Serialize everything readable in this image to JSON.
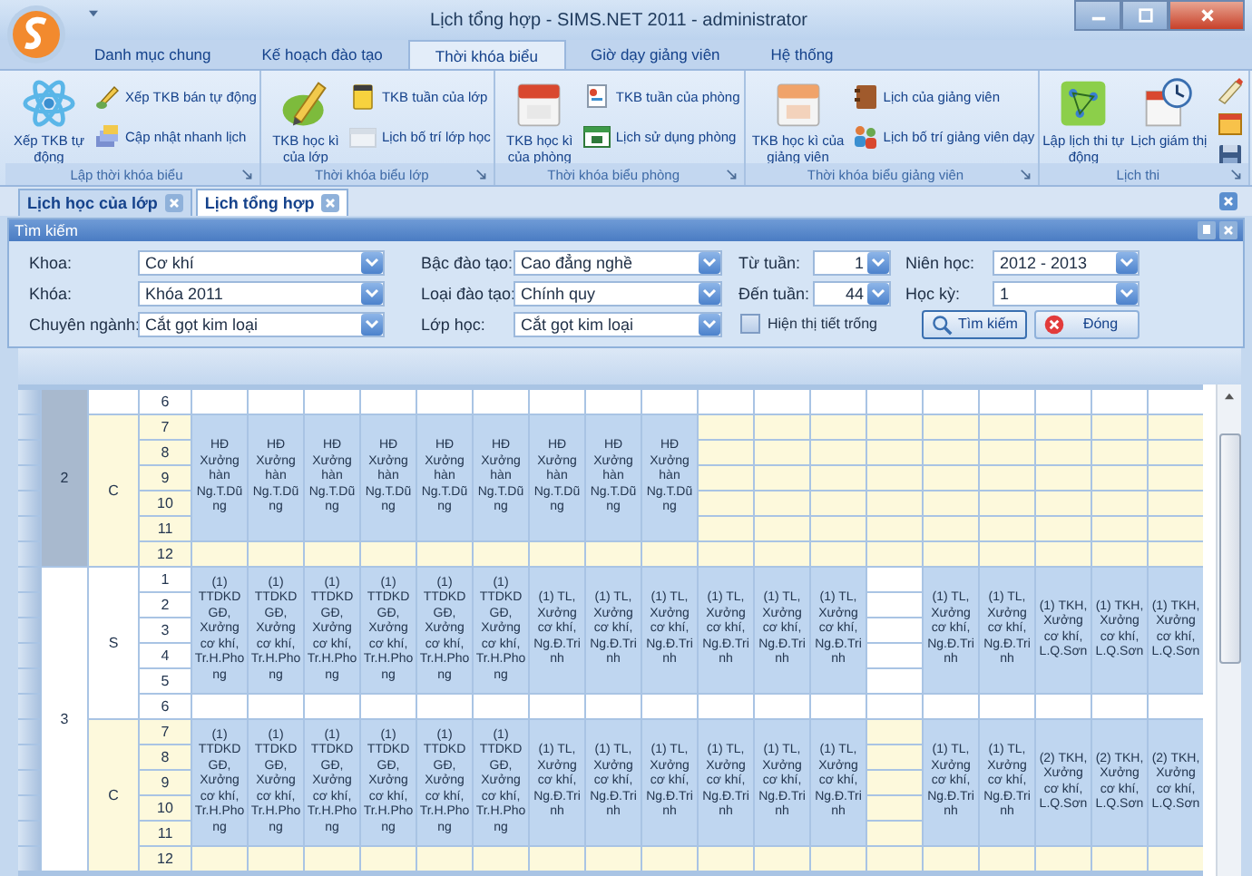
{
  "window": {
    "title": "Lịch tổng hợp - SIMS.NET 2011 - administrator"
  },
  "ribbon": {
    "tabs": [
      {
        "label": "Danh mục chung",
        "selected": false
      },
      {
        "label": "Kế hoạch đào tạo",
        "selected": false
      },
      {
        "label": "Thời khóa biểu",
        "selected": true
      },
      {
        "label": "Giờ dạy giảng viên",
        "selected": false
      },
      {
        "label": "Hệ thống",
        "selected": false
      }
    ],
    "groups": [
      {
        "label": "Lập thời khóa biểu",
        "large": [
          "Xếp TKB tự động"
        ],
        "small": [
          "Xếp TKB bán tự động",
          "Cập nhật nhanh lịch"
        ]
      },
      {
        "label": "Thời khóa biểu lớp",
        "large": [
          "TKB học kì của lớp"
        ],
        "small": [
          "TKB tuần của lớp",
          "Lịch bố trí lớp học"
        ]
      },
      {
        "label": "Thời khóa biểu phòng",
        "large": [
          "TKB học kì của phòng"
        ],
        "small": [
          "TKB tuần của phòng",
          "Lịch sử dụng phòng"
        ]
      },
      {
        "label": "Thời khóa biểu giảng viên",
        "large": [
          "TKB học kì của giảng viên"
        ],
        "small": [
          "Lịch của giảng viên",
          "Lịch bố trí giảng viên dạy"
        ]
      },
      {
        "label": "Lịch thi",
        "large": [
          "Lập lịch thi tự động",
          "Lịch giám thị"
        ]
      }
    ]
  },
  "document_tabs": [
    {
      "label": "Lịch học của lớp",
      "selected": false
    },
    {
      "label": "Lịch tổng hợp",
      "selected": true
    }
  ],
  "search_panel": {
    "title": "Tìm kiếm",
    "rows": [
      [
        {
          "label": "Khoa:",
          "value": "Cơ khí"
        },
        {
          "label": "Bậc đào tạo:",
          "value": "Cao đẳng nghề"
        },
        {
          "label": "Từ tuần:",
          "value": "1"
        },
        {
          "label": "Niên học:",
          "value": "2012 - 2013"
        }
      ],
      [
        {
          "label": "Khóa:",
          "value": "Khóa 2011"
        },
        {
          "label": "Loại đào tạo:",
          "value": "Chính quy"
        },
        {
          "label": "Đến tuần:",
          "value": "44"
        },
        {
          "label": "Học kỳ:",
          "value": "1"
        }
      ],
      [
        {
          "label": "Chuyên ngành:",
          "value": "Cắt gọt kim loại"
        },
        {
          "label": "Lớp học:",
          "value": "Cắt gọt kim loại"
        }
      ]
    ],
    "checkbox": {
      "label": "Hiện thị tiết trống",
      "checked": false
    },
    "buttons": [
      {
        "label": "Tìm kiếm"
      },
      {
        "label": "Đóng"
      }
    ]
  },
  "schedule": {
    "days": [
      {
        "label": "2",
        "selected": true,
        "sessions": [
          {
            "kind": "morning",
            "free_periods": [
              "6"
            ]
          },
          {
            "label": "C",
            "kind": "afternoon",
            "lesson_periods": [
              "7",
              "8",
              "9",
              "10",
              "11"
            ],
            "free_periods": [
              "12"
            ],
            "cells": [
              {
                "kind": "lesson",
                "text": "HĐ Xưởng hàn Ng.T.Dũng"
              },
              {
                "kind": "lesson",
                "text": "HĐ Xưởng hàn Ng.T.Dũng"
              },
              {
                "kind": "lesson",
                "text": "HĐ Xưởng hàn Ng.T.Dũng"
              },
              {
                "kind": "lesson",
                "text": "HĐ Xưởng hàn Ng.T.Dũng"
              },
              {
                "kind": "lesson",
                "text": "HĐ Xưởng hàn Ng.T.Dũng"
              },
              {
                "kind": "lesson",
                "text": "HĐ Xưởng hàn Ng.T.Dũng"
              },
              {
                "kind": "lesson",
                "text": "HĐ Xưởng hàn Ng.T.Dũng"
              },
              {
                "kind": "lesson",
                "text": "HĐ Xưởng hàn Ng.T.Dũng"
              },
              {
                "kind": "lesson",
                "text": "HĐ Xưởng hàn Ng.T.Dũng"
              },
              {
                "kind": "free"
              },
              {
                "kind": "free"
              },
              {
                "kind": "free"
              },
              {
                "kind": "free"
              },
              {
                "kind": "free"
              },
              {
                "kind": "free"
              },
              {
                "kind": "free"
              },
              {
                "kind": "free"
              },
              {
                "kind": "free"
              }
            ]
          }
        ]
      },
      {
        "label": "3",
        "selected": false,
        "sessions": [
          {
            "label": "S",
            "kind": "morning",
            "lesson_periods": [
              "1",
              "2",
              "3",
              "4",
              "5"
            ],
            "free_periods": [
              "6"
            ],
            "cells": [
              {
                "kind": "lesson",
                "text": "(1) TTDKD GĐ, Xưởng cơ khí, Tr.H.Phong"
              },
              {
                "kind": "lesson",
                "text": "(1) TTDKD GĐ, Xưởng cơ khí, Tr.H.Phong"
              },
              {
                "kind": "lesson",
                "text": "(1) TTDKD GĐ, Xưởng cơ khí, Tr.H.Phong"
              },
              {
                "kind": "lesson",
                "text": "(1) TTDKD GĐ, Xưởng cơ khí, Tr.H.Phong"
              },
              {
                "kind": "lesson",
                "text": "(1) TTDKD GĐ, Xưởng cơ khí, Tr.H.Phong"
              },
              {
                "kind": "lesson",
                "text": "(1) TTDKD GĐ, Xưởng cơ khí, Tr.H.Phong"
              },
              {
                "kind": "lesson",
                "text": "(1) TL, Xưởng cơ khí, Ng.Đ.Trinh"
              },
              {
                "kind": "lesson",
                "text": "(1) TL, Xưởng cơ khí, Ng.Đ.Trinh"
              },
              {
                "kind": "lesson",
                "text": "(1) TL, Xưởng cơ khí, Ng.Đ.Trinh"
              },
              {
                "kind": "lesson",
                "text": "(1) TL, Xưởng cơ khí, Ng.Đ.Trinh"
              },
              {
                "kind": "lesson",
                "text": "(1) TL, Xưởng cơ khí, Ng.Đ.Trinh"
              },
              {
                "kind": "lesson",
                "text": "(1) TL, Xưởng cơ khí, Ng.Đ.Trinh"
              },
              {
                "kind": "free"
              },
              {
                "kind": "lesson",
                "text": "(1) TL, Xưởng cơ khí, Ng.Đ.Trinh"
              },
              {
                "kind": "lesson",
                "text": "(1) TL, Xưởng cơ khí, Ng.Đ.Trinh"
              },
              {
                "kind": "lesson",
                "text": "(1) TKH, Xưởng cơ khí, L.Q.Sơn"
              },
              {
                "kind": "lesson",
                "text": "(1) TKH, Xưởng cơ khí, L.Q.Sơn"
              },
              {
                "kind": "lesson",
                "text": "(1) TKH, Xưởng cơ khí, L.Q.Sơn"
              }
            ]
          },
          {
            "label": "C",
            "kind": "afternoon",
            "lesson_periods": [
              "7",
              "8",
              "9",
              "10",
              "11"
            ],
            "free_periods": [
              "12"
            ],
            "cells": [
              {
                "kind": "lesson",
                "text": "(1) TTDKD GĐ, Xưởng cơ khí, Tr.H.Phong"
              },
              {
                "kind": "lesson",
                "text": "(1) TTDKD GĐ, Xưởng cơ khí, Tr.H.Phong"
              },
              {
                "kind": "lesson",
                "text": "(1) TTDKD GĐ, Xưởng cơ khí, Tr.H.Phong"
              },
              {
                "kind": "lesson",
                "text": "(1) TTDKD GĐ, Xưởng cơ khí, Tr.H.Phong"
              },
              {
                "kind": "lesson",
                "text": "(1) TTDKD GĐ, Xưởng cơ khí, Tr.H.Phong"
              },
              {
                "kind": "lesson",
                "text": "(1) TTDKD GĐ, Xưởng cơ khí, Tr.H.Phong"
              },
              {
                "kind": "lesson",
                "text": "(1) TL, Xưởng cơ khí, Ng.Đ.Trinh"
              },
              {
                "kind": "lesson",
                "text": "(1) TL, Xưởng cơ khí, Ng.Đ.Trinh"
              },
              {
                "kind": "lesson",
                "text": "(1) TL, Xưởng cơ khí, Ng.Đ.Trinh"
              },
              {
                "kind": "lesson",
                "text": "(1) TL, Xưởng cơ khí, Ng.Đ.Trinh"
              },
              {
                "kind": "lesson",
                "text": "(1) TL, Xưởng cơ khí, Ng.Đ.Trinh"
              },
              {
                "kind": "lesson",
                "text": "(1) TL, Xưởng cơ khí, Ng.Đ.Trinh"
              },
              {
                "kind": "free"
              },
              {
                "kind": "lesson",
                "text": "(1) TL, Xưởng cơ khí, Ng.Đ.Trinh"
              },
              {
                "kind": "lesson",
                "text": "(1) TL, Xưởng cơ khí, Ng.Đ.Trinh"
              },
              {
                "kind": "lesson",
                "text": "(2) TKH, Xưởng cơ khí, L.Q.Sơn"
              },
              {
                "kind": "lesson",
                "text": "(2) TKH, Xưởng cơ khí, L.Q.Sơn"
              },
              {
                "kind": "lesson",
                "text": "(2) TKH, Xưởng cơ khí, L.Q.Sơn"
              }
            ]
          }
        ]
      }
    ]
  }
}
